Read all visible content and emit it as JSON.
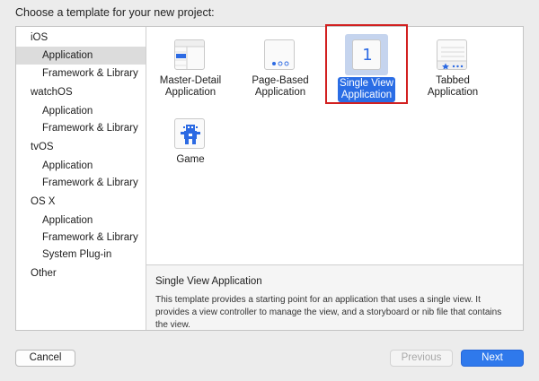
{
  "prompt": "Choose a template for your new project:",
  "sidebar": {
    "sections": [
      {
        "header": "iOS",
        "items": [
          "Application",
          "Framework & Library"
        ]
      },
      {
        "header": "watchOS",
        "items": [
          "Application",
          "Framework & Library"
        ]
      },
      {
        "header": "tvOS",
        "items": [
          "Application",
          "Framework & Library"
        ]
      },
      {
        "header": "OS X",
        "items": [
          "Application",
          "Framework & Library",
          "System Plug-in"
        ]
      },
      {
        "header": "Other",
        "items": []
      }
    ],
    "selected": "iOS / Application"
  },
  "templates": [
    {
      "label": "Master-Detail\nApplication",
      "icon": "master-detail-icon"
    },
    {
      "label": "Page-Based\nApplication",
      "icon": "page-based-icon"
    },
    {
      "label": "Single View\nApplication",
      "icon": "single-view-icon",
      "icon_text": "1",
      "selected": true
    },
    {
      "label": "Tabbed\nApplication",
      "icon": "tabbed-icon"
    },
    {
      "label": "Game",
      "icon": "game-icon"
    }
  ],
  "description": {
    "title": "Single View Application",
    "body": "This template provides a starting point for an application that uses a single view. It provides a view controller to manage the view, and a storyboard or nib file that contains the view."
  },
  "buttons": {
    "cancel": "Cancel",
    "previous": "Previous",
    "next": "Next"
  },
  "colors": {
    "accent": "#2a6de5",
    "selection_outline": "#d22020",
    "sidebar_selected": "#dcdcdc"
  }
}
